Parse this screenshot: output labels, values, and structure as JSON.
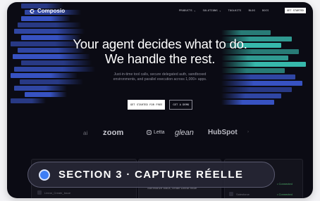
{
  "nav": {
    "brand": "Composio",
    "links": [
      "PRODUCTS ⌄",
      "SOLUTIONS ⌄",
      "TOOLKITS",
      "BLOG",
      "DOCS"
    ],
    "cta": "GET STARTED"
  },
  "hero": {
    "title_line1": "Your agent decides what to do.",
    "title_line2": "We handle the rest.",
    "subtitle_line1": "Just-in-time tool calls, secure delegated auth, sandboxed",
    "subtitle_line2": "environments, and parallel execution across 1,000+ apps.",
    "primary_button": "GET STARTED FOR FREE",
    "secondary_button": "GET A DEMO"
  },
  "logos": {
    "ai": "ai",
    "zoom": "zoom",
    "letta": "Letta",
    "glean": "glean",
    "hubspot": "HubSpot",
    "more": "›"
  },
  "preview": {
    "row_left": "Linear_Create_Issue",
    "middle_hint": "Summarize Slack, create Linear issue",
    "right_item": "Salesforce",
    "status_1": "• Connected",
    "status_2": "• Connected"
  },
  "overlay": {
    "label": "SECTION 3 · CAPTURE RÉELLE"
  },
  "colors": {
    "background": "#0b0b14",
    "bar_blue": "#3f5fe0",
    "bar_cyan": "#3fd6c6",
    "pill_dot": "#3d7ef5"
  }
}
